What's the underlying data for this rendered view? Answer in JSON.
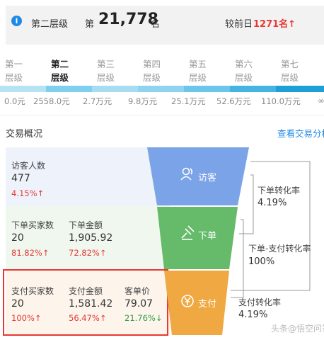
{
  "rank": {
    "level_name": "第二层级",
    "prefix": "第",
    "number": "21,778",
    "suffix": "名",
    "prev_label": "较前日",
    "prev_value": "1271名↑"
  },
  "tiers": [
    {
      "line1": "第一",
      "line2": "层级",
      "value": "0.0元",
      "active": false
    },
    {
      "line1": "第二",
      "line2": "层级",
      "value": "2558.0元",
      "active": true
    },
    {
      "line1": "第三",
      "line2": "层级",
      "value": "2.7万元",
      "active": false
    },
    {
      "line1": "第四",
      "line2": "层级",
      "value": "9.8万元",
      "active": false
    },
    {
      "line1": "第五",
      "line2": "层级",
      "value": "25.1万元",
      "active": false
    },
    {
      "line1": "第六",
      "line2": "层级",
      "value": "52.6万元",
      "active": false
    },
    {
      "line1": "第七",
      "line2": "层级",
      "value": "110.0万元",
      "active": false
    }
  ],
  "tier_last_value": "∞",
  "section": {
    "title": "交易概况",
    "link": "查看交易分析"
  },
  "visitors": {
    "label": "访客人数",
    "value": "477",
    "pct": "4.15%↑"
  },
  "orders": {
    "buyers_label": "下单买家数",
    "buyers_value": "20",
    "buyers_pct": "81.82%↑",
    "amount_label": "下单金额",
    "amount_value": "1,905.92",
    "amount_pct": "72.82%↑"
  },
  "payments": {
    "buyers_label": "支付买家数",
    "buyers_value": "20",
    "buyers_pct": "100%↑",
    "amount_label": "支付金额",
    "amount_value": "1,581.42",
    "amount_pct": "56.47%↑",
    "avg_label": "客单价",
    "avg_value": "79.07",
    "avg_pct": "21.76%↓"
  },
  "funnel": {
    "visit_label": "访客",
    "order_label": "下单",
    "pay_label": "支付",
    "visit_color": "#7ba3e8",
    "order_color": "#66bb6a",
    "pay_color": "#f0a842"
  },
  "conversions": {
    "order_rate_label": "下单转化率",
    "order_rate_value": "4.19%",
    "order_pay_label": "下单-支付转化率",
    "order_pay_value": "100%",
    "pay_rate_label": "支付转化率",
    "pay_rate_value": "4.19%"
  },
  "watermark": "头条@悟空问答"
}
